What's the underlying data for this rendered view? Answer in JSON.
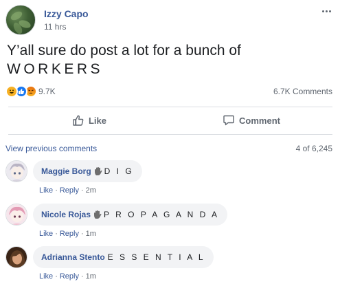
{
  "post": {
    "author": "Izzy Capo",
    "time": "11 hrs",
    "text_line1": "Y’all sure do post a lot for a bunch of",
    "text_line2": "WORKERS",
    "reaction_count": "9.7K",
    "comment_count": "6.7K Comments",
    "reactions": [
      "haha",
      "like",
      "angry"
    ]
  },
  "actions": {
    "like_label": "Like",
    "comment_label": "Comment"
  },
  "comments_header": {
    "view_previous": "View previous comments",
    "pager": "4 of 6,245"
  },
  "comments": [
    {
      "name": "Maggie Borg",
      "text": "D I G",
      "like": "Like",
      "reply": "Reply",
      "time": "2m",
      "avatar": "anime-girl-avatar"
    },
    {
      "name": "Nicole Rojas",
      "text": "P R O P A G A N D A",
      "like": "Like",
      "reply": "Reply",
      "time": "1m",
      "avatar": "anime-girl-pink-avatar"
    },
    {
      "name": "Adrianna Stento",
      "text": "E S S E N T I A L",
      "like": "Like",
      "reply": "Reply",
      "time": "1m",
      "avatar": "photo-avatar"
    }
  ],
  "colors": {
    "link": "#385898",
    "muted": "#606770",
    "bubble": "#f2f3f5",
    "divider": "#dadde1"
  }
}
